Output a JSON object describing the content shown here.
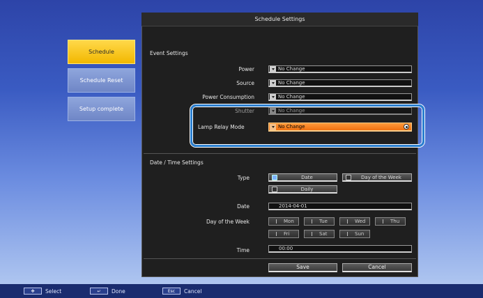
{
  "title": "Schedule Settings",
  "menu": [
    {
      "label": "Schedule",
      "active": true
    },
    {
      "label": "Schedule Reset",
      "active": false
    },
    {
      "label": "Setup complete",
      "active": false
    }
  ],
  "event_settings": {
    "heading": "Event Settings",
    "rows": [
      {
        "label": "Power",
        "value": "No Change"
      },
      {
        "label": "Source",
        "value": "No Change"
      },
      {
        "label": "Power Consumption",
        "value": "No Change"
      },
      {
        "label": "Shutter",
        "value": "No Change"
      },
      {
        "label": "Lamp Relay Mode",
        "value": "No Change"
      }
    ]
  },
  "datetime_settings": {
    "heading": "Date / Time Settings",
    "type_label": "Type",
    "type_options": [
      "Date",
      "Day of the Week",
      "Daily"
    ],
    "type_selected": "Date",
    "date_label": "Date",
    "date_value": "2014-04-01",
    "dow_label": "Day of the Week",
    "days": [
      "Mon",
      "Tue",
      "Wed",
      "Thu",
      "Fri",
      "Sat",
      "Sun"
    ],
    "time_label": "Time",
    "time_value": "00:00"
  },
  "actions": {
    "save": "Save",
    "cancel": "Cancel"
  },
  "statusbar": {
    "select_key": "✥",
    "select": "Select",
    "done_key": "↵",
    "done": "Done",
    "cancel_key": "Esc",
    "cancel": "Cancel"
  },
  "colors": {
    "accent": "#f07010",
    "highlight": "#2a7fd0",
    "menu_active": "#f2b800"
  }
}
